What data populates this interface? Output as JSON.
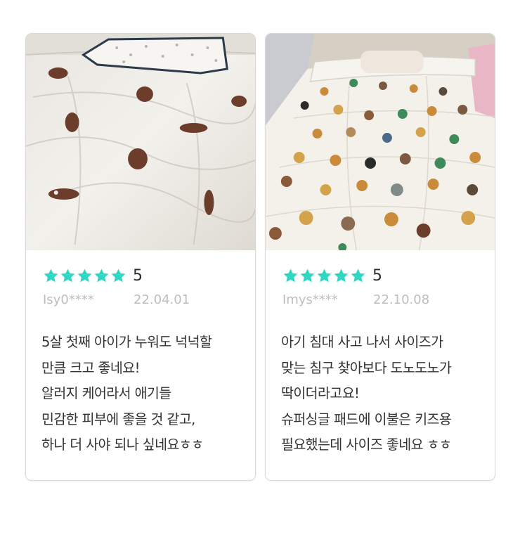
{
  "colors": {
    "star": "#2ed8c3",
    "text": "#333333",
    "meta": "#bdbdbd",
    "border": "#d9d9d9"
  },
  "reviews": [
    {
      "photo": "bedding-with-bear-pattern-photo",
      "stars": 5,
      "score": "5",
      "user": "Isy0****",
      "date": "22.04.01",
      "lines": [
        "5살 첫째 아이가 누워도 넉넉할",
        "만큼 크고 좋네요!",
        "알러지 케어라서 애기들",
        "민감한 피부에 좋을 것 같고,",
        "하나 더 사야 되나 싶네요ㅎㅎ"
      ]
    },
    {
      "photo": "bedding-with-animal-faces-photo",
      "stars": 5,
      "score": "5",
      "user": "Imys****",
      "date": "22.10.08",
      "lines": [
        "아기 침대 사고 나서 사이즈가",
        "맞는 침구 찾아보다 도노도노가",
        "딱이더라고요!",
        "슈퍼싱글 패드에 이불은 키즈용",
        "필요했는데 사이즈 좋네요 ㅎㅎ"
      ]
    }
  ]
}
